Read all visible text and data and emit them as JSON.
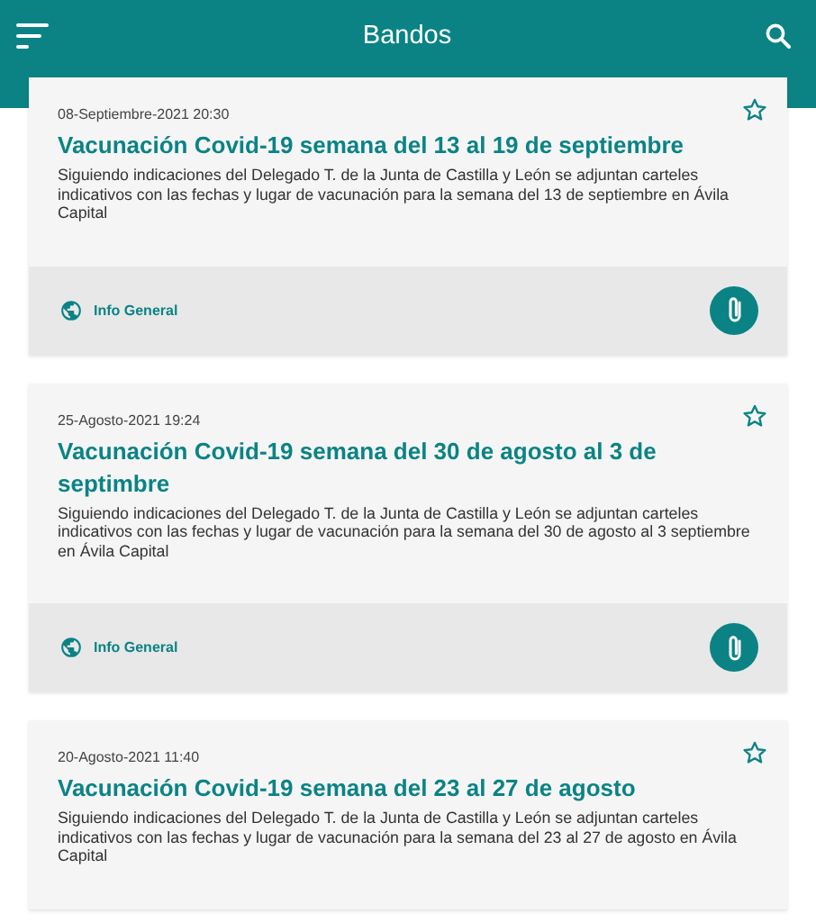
{
  "app_bar": {
    "title": "Bandos"
  },
  "cards": [
    {
      "date": "08-Septiembre-2021 20:30",
      "starred": false,
      "title": "Vacunación Covid-19 semana del 13 al 19 de septiembre",
      "body": "Siguiendo indicaciones del Delegado T. de la Junta de Castilla y León se adjuntan carteles indicativos con las fechas y lugar de vacunación para la semana del 13 de septiembre en Ávila Capital",
      "category": "Info General",
      "has_attachment": true
    },
    {
      "date": "25-Agosto-2021 19:24",
      "starred": false,
      "title": "Vacunación Covid-19 semana del 30 de agosto al 3 de septimbre",
      "body": "Siguiendo indicaciones del Delegado T. de la Junta de Castilla y León se adjuntan carteles indicativos con las fechas y lugar de vacunación para la semana del 30 de agosto al 3 septiembre en Ávila Capital",
      "category": "Info General",
      "has_attachment": true
    },
    {
      "date": "20-Agosto-2021 11:40",
      "starred": false,
      "title": "Vacunación Covid-19 semana del 23 al 27 de agosto",
      "body": "Siguiendo indicaciones del Delegado T. de la Junta de Castilla y León se adjuntan carteles indicativos con las fechas y lugar de vacunación para la semana del 23 al 27 de agosto en Ávila Capital"
    }
  ]
}
